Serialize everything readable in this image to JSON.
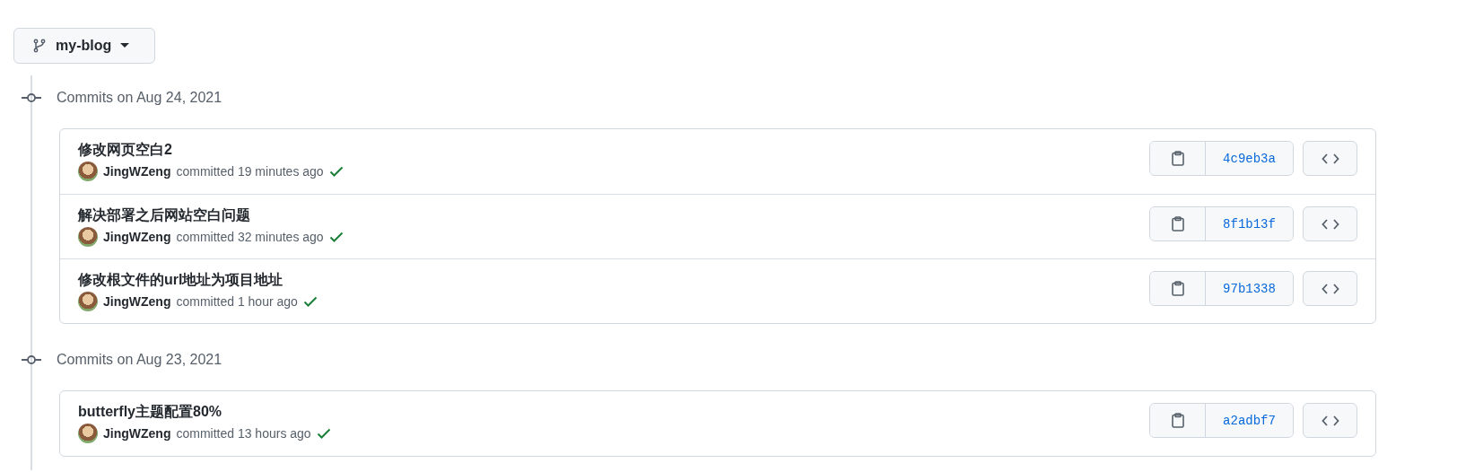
{
  "branch": {
    "label": "my-blog"
  },
  "groups": [
    {
      "heading": "Commits on Aug 24, 2021",
      "commits": [
        {
          "title": "修改网页空白2",
          "author": "JingWZeng",
          "action": "committed",
          "time": "19 minutes ago",
          "verified": true,
          "sha": "4c9eb3a"
        },
        {
          "title": "解决部署之后网站空白问题",
          "author": "JingWZeng",
          "action": "committed",
          "time": "32 minutes ago",
          "verified": true,
          "sha": "8f1b13f"
        },
        {
          "title": "修改根文件的url地址为项目地址",
          "author": "JingWZeng",
          "action": "committed",
          "time": "1 hour ago",
          "verified": true,
          "sha": "97b1338"
        }
      ]
    },
    {
      "heading": "Commits on Aug 23, 2021",
      "commits": [
        {
          "title": "butterfly主题配置80%",
          "author": "JingWZeng",
          "action": "committed",
          "time": "13 hours ago",
          "verified": true,
          "sha": "a2adbf7"
        }
      ]
    }
  ]
}
